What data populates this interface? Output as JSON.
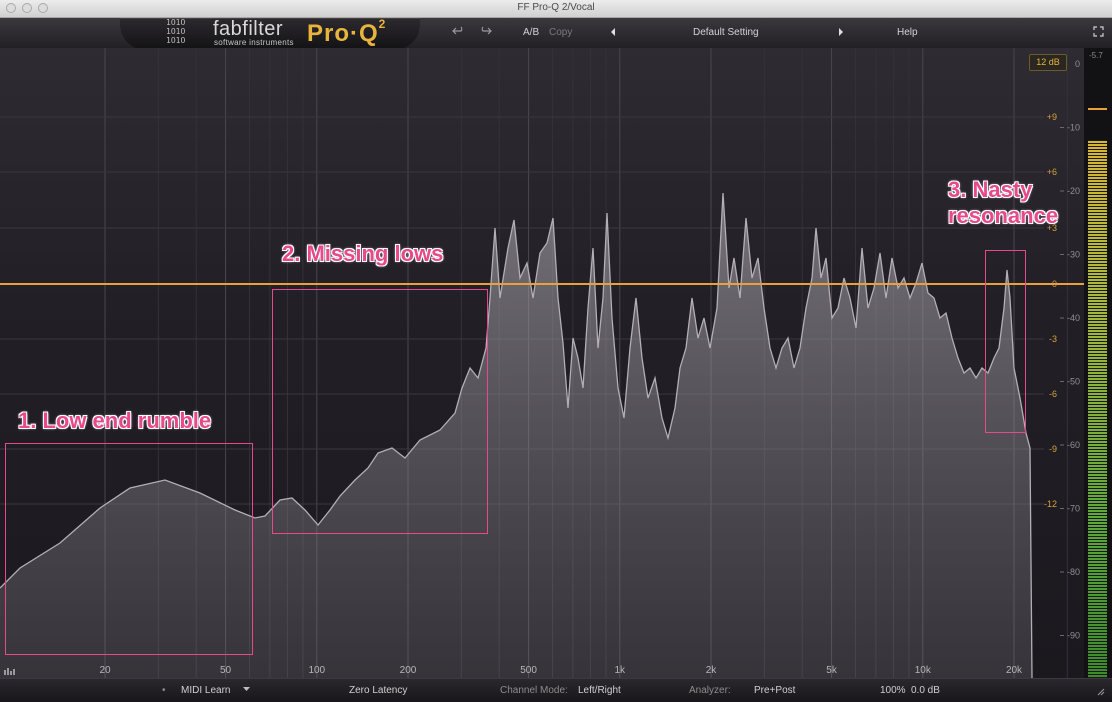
{
  "window": {
    "title": "FF Pro-Q 2/Vocal"
  },
  "header": {
    "logo_glyph": "1O1O\n1O1O\n1O1O",
    "brand": "fabfilter",
    "brand_sub": "software instruments",
    "product": "Pro·Q",
    "product_version": "2",
    "undo_icon": "undo-icon",
    "redo_icon": "redo-icon",
    "ab_label": "A/B",
    "copy_label": "Copy",
    "preset_name": "Default Setting",
    "help_label": "Help"
  },
  "graph": {
    "range_badge": "12 dB",
    "eq_scale": [
      "+9",
      "+6",
      "+3",
      "0",
      "-3",
      "-6",
      "-9",
      "-12"
    ],
    "analyzer_scale": [
      "0",
      "-10",
      "-20",
      "-30",
      "-40",
      "-50",
      "-60",
      "-70",
      "-80",
      "-90"
    ],
    "freq_labels": [
      "20",
      "50",
      "100",
      "200",
      "500",
      "1k",
      "2k",
      "5k",
      "10k",
      "20k"
    ],
    "meter_peak": "-5.7",
    "colors": {
      "eq_line": "#e9a23b",
      "spectrum_fill": "#9c969e",
      "annotation": "#e7498c"
    }
  },
  "annotations": [
    {
      "label": "1. Low end rumble"
    },
    {
      "label": "2. Missing lows"
    },
    {
      "label": "3. Nasty\nresonance"
    }
  ],
  "footer": {
    "midi_learn": "MIDI Learn",
    "latency": "Zero Latency",
    "channel_mode_label": "Channel Mode:",
    "channel_mode_value": "Left/Right",
    "analyzer_label": "Analyzer:",
    "analyzer_value": "Pre+Post",
    "zoom": "100%",
    "output_gain": "0.0 dB"
  }
}
